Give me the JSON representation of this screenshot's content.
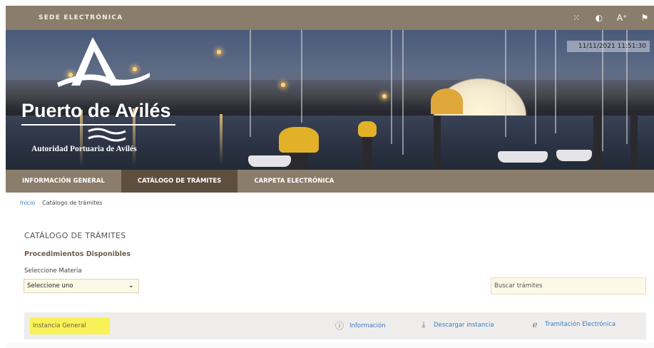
{
  "topbar": {
    "title": "SEDE ELECTRÓNICA",
    "tools": [
      {
        "name": "sitemap-icon",
        "glyph": "⁙"
      },
      {
        "name": "contrast-icon",
        "glyph": "◐"
      },
      {
        "name": "font-size-icon",
        "glyph": "A⁺"
      },
      {
        "name": "flag-icon",
        "glyph": "⚑"
      }
    ]
  },
  "banner": {
    "datetime": "11/11/2021 11:51:30",
    "logo_title": "Puerto de Avilés",
    "logo_subtitle": "Autoridad Portuaria de Avilés"
  },
  "nav": {
    "items": [
      {
        "label": "INFORMACIÓN GENERAL",
        "active": false
      },
      {
        "label": "CATÁLOGO DE TRÁMITES",
        "active": true
      },
      {
        "label": "CARPETA ELECTRÓNICA",
        "active": false
      }
    ]
  },
  "breadcrumb": {
    "home": "Inicio",
    "current": "Catálogo de trámites"
  },
  "main": {
    "title": "CATÁLOGO DE TRÁMITES",
    "subtitle": "Procedimientos Disponibles",
    "select_label": "Seleccione Materia",
    "select_value": "Seleccione uno",
    "search_placeholder": "Buscar trámites",
    "procedures": [
      {
        "name": "Instancia General",
        "info_label": "Información",
        "download_label": "Descargar instancia",
        "electronic_label": "Tramitación Electrónica"
      }
    ]
  },
  "colors": {
    "brand_brown": "#8b7d6b",
    "active_tab": "#5e4e3e",
    "link_blue": "#3a7bbf",
    "highlight_yellow": "#f8f258"
  }
}
